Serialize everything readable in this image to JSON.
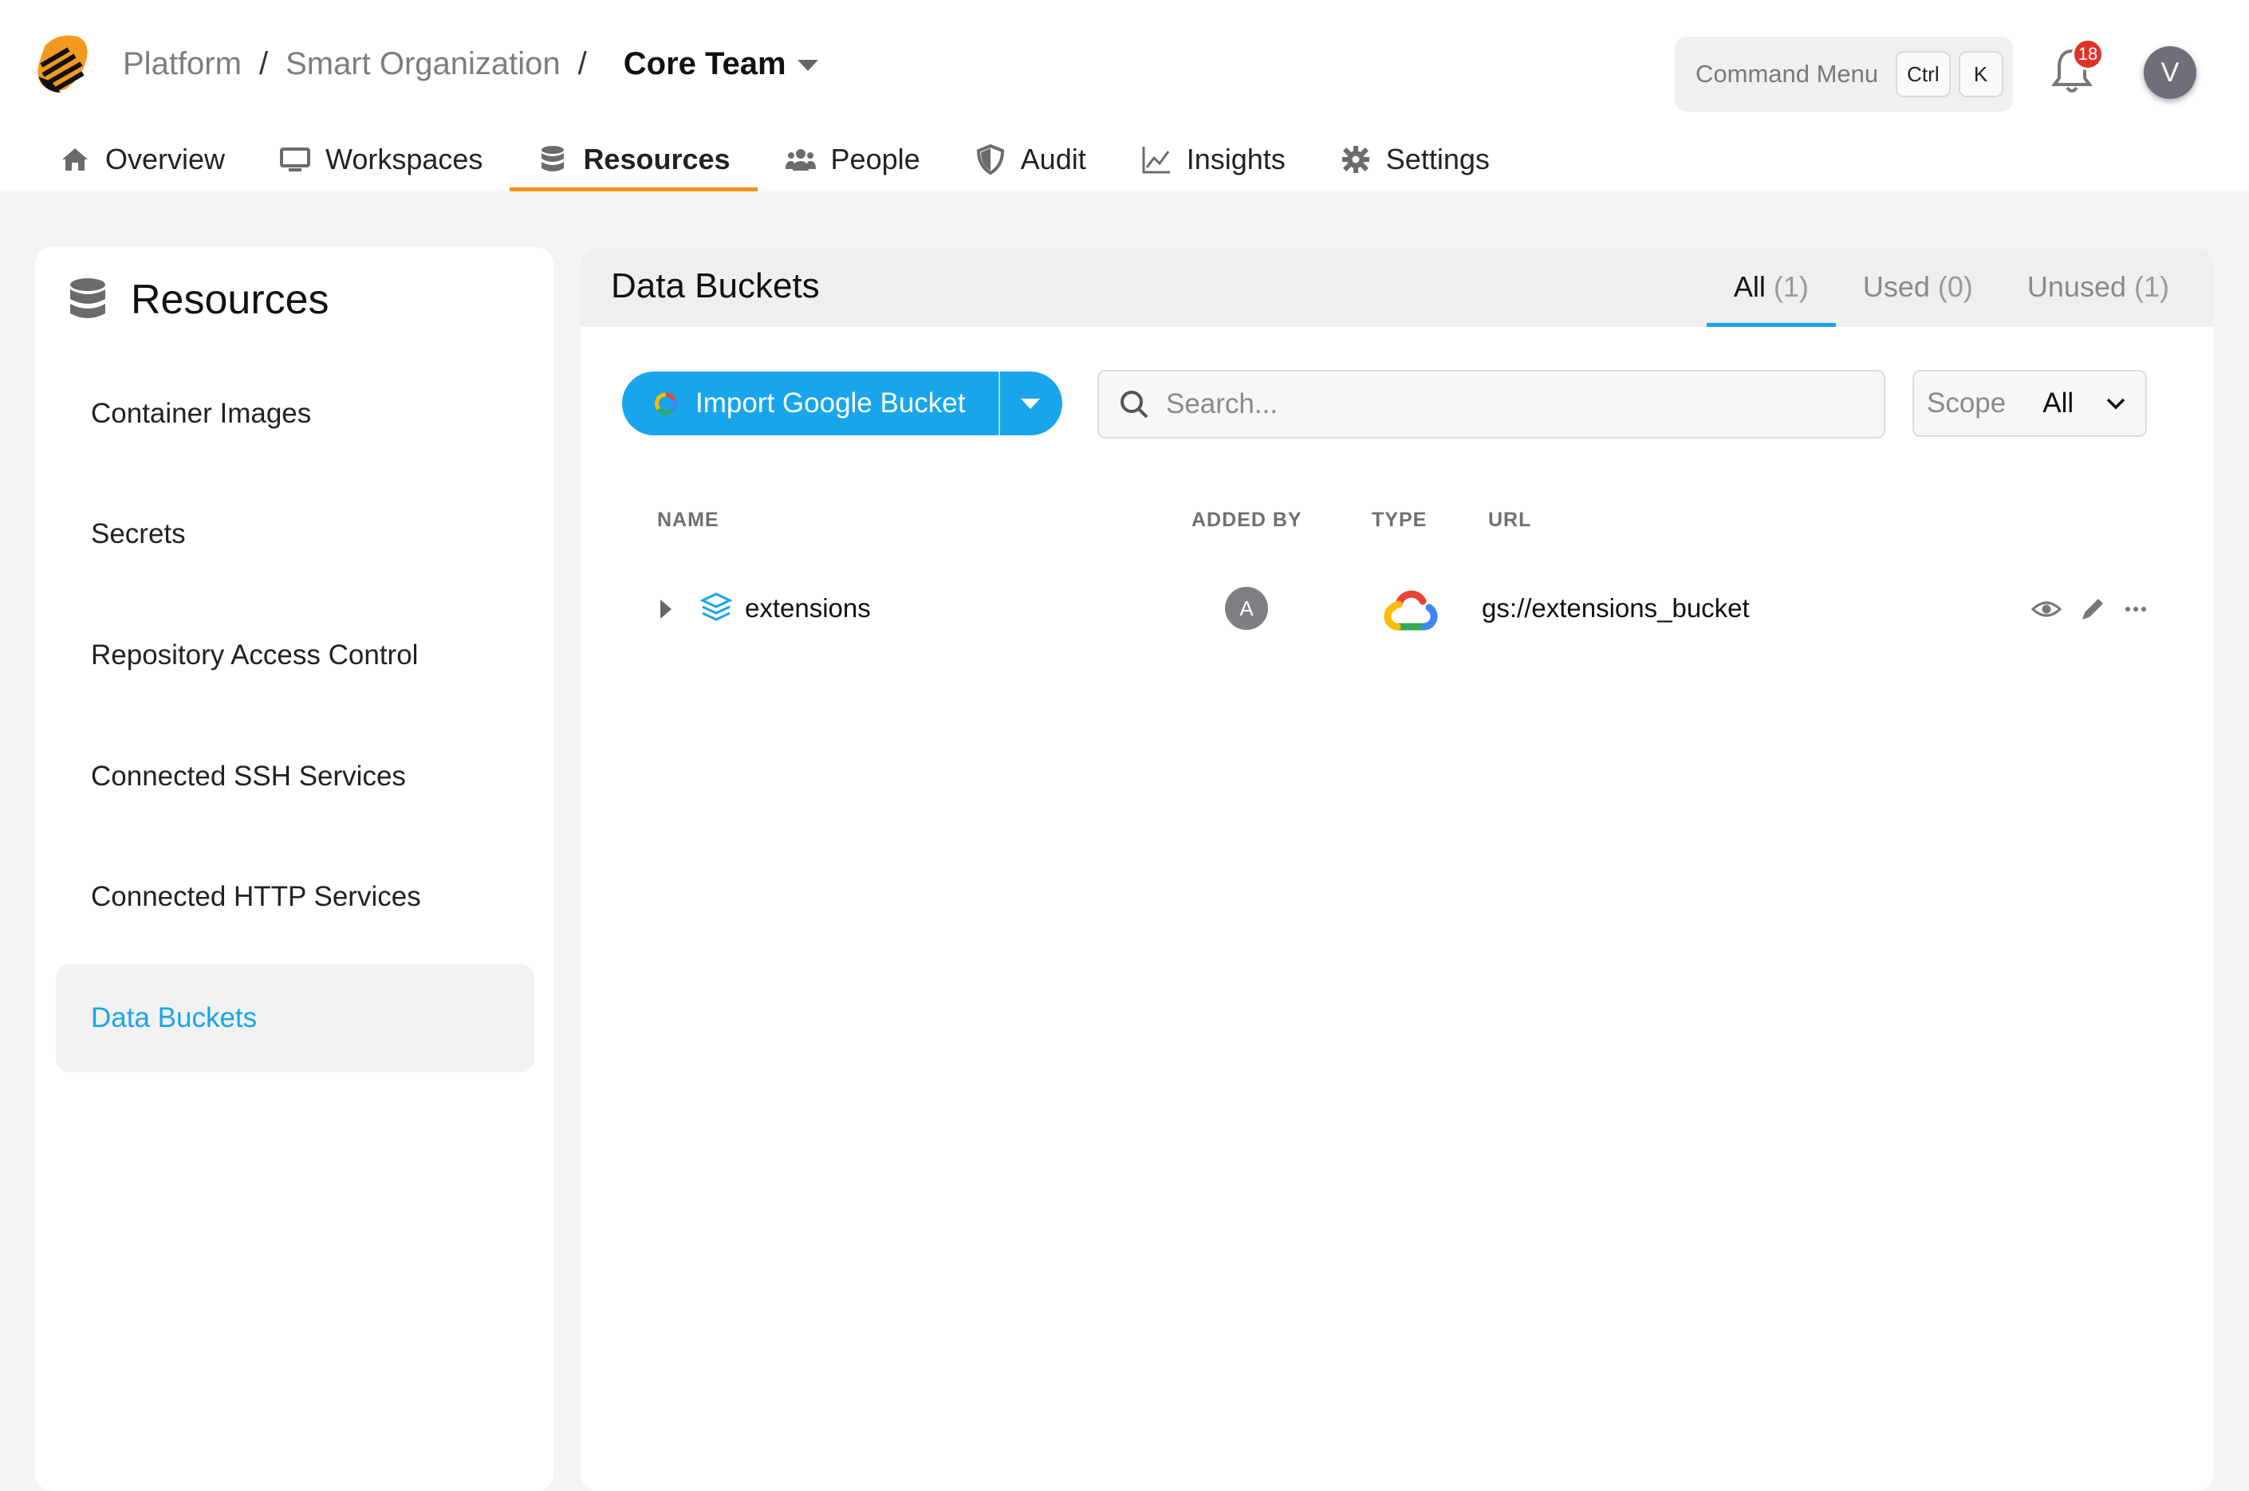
{
  "header": {
    "breadcrumb": [
      "Platform",
      "Smart Organization"
    ],
    "breadcrumb_separator": "/",
    "current": "Core Team",
    "command_menu": {
      "label": "Command Menu",
      "keys": [
        "Ctrl",
        "K"
      ]
    },
    "notification_count": "18",
    "user_initial": "V"
  },
  "nav": {
    "items": [
      {
        "label": "Overview",
        "icon": "home-icon"
      },
      {
        "label": "Workspaces",
        "icon": "monitor-icon"
      },
      {
        "label": "Resources",
        "icon": "database-icon",
        "active": true
      },
      {
        "label": "People",
        "icon": "people-icon"
      },
      {
        "label": "Audit",
        "icon": "shield-icon"
      },
      {
        "label": "Insights",
        "icon": "chart-line-icon"
      },
      {
        "label": "Settings",
        "icon": "gear-icon"
      }
    ]
  },
  "sidebar": {
    "title": "Resources",
    "items": [
      {
        "label": "Container Images"
      },
      {
        "label": "Secrets"
      },
      {
        "label": "Repository Access Control"
      },
      {
        "label": "Connected SSH Services"
      },
      {
        "label": "Connected HTTP Services"
      },
      {
        "label": "Data Buckets",
        "active": true
      }
    ]
  },
  "main": {
    "title": "Data Buckets",
    "tabs": [
      {
        "label": "All",
        "count": "(1)",
        "active": true
      },
      {
        "label": "Used",
        "count": "(0)"
      },
      {
        "label": "Unused",
        "count": "(1)"
      }
    ],
    "import_button": "Import Google Bucket",
    "search_placeholder": "Search...",
    "scope": {
      "label": "Scope",
      "value": "All"
    },
    "columns": [
      "NAME",
      "ADDED BY",
      "TYPE",
      "URL"
    ],
    "rows": [
      {
        "name": "extensions",
        "added_by": "A",
        "type": "google-cloud-icon",
        "url": "gs://extensions_bucket"
      }
    ]
  },
  "colors": {
    "accent": "#1aa4e8",
    "nav_active_underline": "#f0961e",
    "badge": "#e0322b"
  }
}
